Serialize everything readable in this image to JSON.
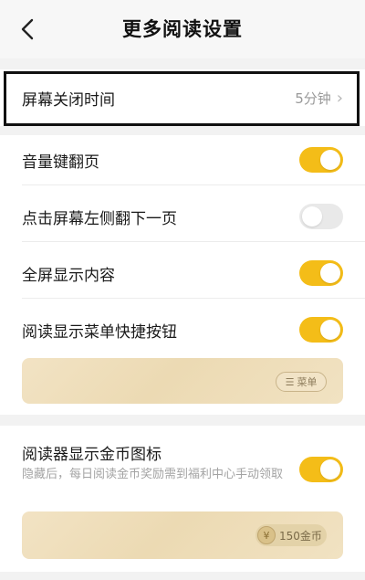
{
  "header": {
    "title": "更多阅读设置",
    "back_icon": "chevron-left-icon"
  },
  "settings": {
    "screen_off": {
      "label": "屏幕关闭时间",
      "value": "5分钟",
      "chevron": "›"
    },
    "volume_flip": {
      "label": "音量键翻页",
      "enabled": true
    },
    "tap_left_next": {
      "label": "点击屏幕左侧翻下一页",
      "enabled": false
    },
    "fullscreen": {
      "label": "全屏显示内容",
      "enabled": true
    },
    "menu_button": {
      "label": "阅读显示菜单快捷按钮",
      "enabled": true,
      "preview_label": "菜单",
      "preview_icon": "☰"
    },
    "coin_icon": {
      "label": "阅读器显示金币图标",
      "description": "隐藏后，每日阅读金币奖励需到福利中心手动领取",
      "enabled": true,
      "preview_label": "150金币",
      "preview_icon": "¥"
    }
  },
  "colors": {
    "toggle_on": "#f4bd18",
    "toggle_off": "#e9e9e9",
    "highlight_border": "#111111"
  }
}
